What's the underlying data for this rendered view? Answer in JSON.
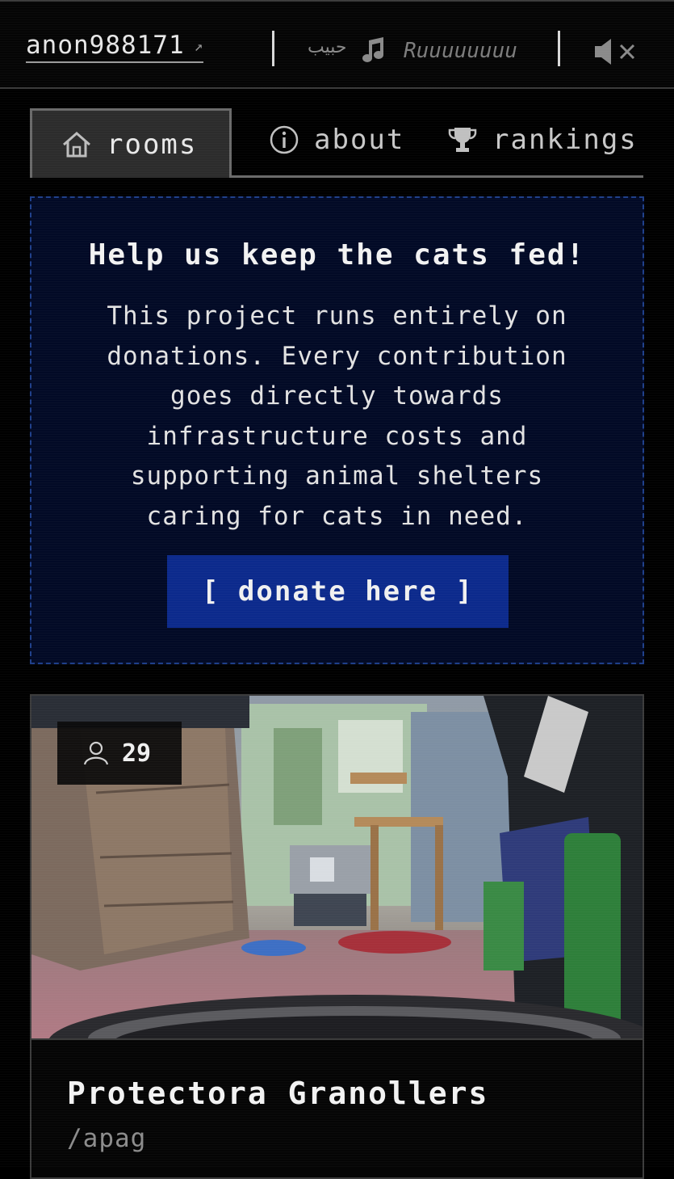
{
  "header": {
    "username": "anon988171",
    "username_link_icon": "external-arrow-icon",
    "station_name": "حبيب",
    "music_icon": "music-note-icon",
    "now_playing": "Ruuuuuuuu",
    "mute_icon": "speaker-muted-icon"
  },
  "tabs": [
    {
      "label": "rooms",
      "icon": "home-icon",
      "active": true
    },
    {
      "label": "about",
      "icon": "info-icon",
      "active": false
    },
    {
      "label": "rankings",
      "icon": "trophy-icon",
      "active": false
    }
  ],
  "donate": {
    "title": "Help us keep the cats fed!",
    "body": "This project runs entirely on donations. Every contribution goes directly towards infrastructure costs and supporting animal shelters caring for cats in need.",
    "button_label": "[ donate here ]"
  },
  "rooms": [
    {
      "viewer_icon": "user-icon",
      "viewers": "29",
      "name": "Protectora Granollers",
      "slug": "/apag"
    }
  ],
  "colors": {
    "background": "#000000",
    "donate_bg": "#020a26",
    "donate_border": "#1f3f8a",
    "donate_button": "#0c2a8c",
    "active_tab_bg": "#2c2c2c"
  }
}
